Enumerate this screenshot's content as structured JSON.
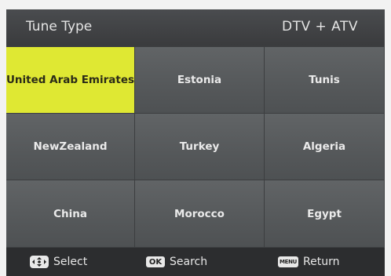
{
  "header": {
    "title": "Tune Type",
    "mode": "DTV + ATV"
  },
  "countries": [
    {
      "label": "United Arab Emirates",
      "selected": true
    },
    {
      "label": "Estonia",
      "selected": false
    },
    {
      "label": "Tunis",
      "selected": false
    },
    {
      "label": "NewZealand",
      "selected": false
    },
    {
      "label": "Turkey",
      "selected": false
    },
    {
      "label": "Algeria",
      "selected": false
    },
    {
      "label": "China",
      "selected": false
    },
    {
      "label": "Morocco",
      "selected": false
    },
    {
      "label": "Egypt",
      "selected": false
    }
  ],
  "footer": {
    "select_label": "Select",
    "search_key": "OK",
    "search_label": "Search",
    "return_key": "MENU",
    "return_label": "Return"
  },
  "colors": {
    "selected_background": "#dfe833",
    "cell_background": "#5b5e60",
    "footer_background": "#2c2d2f"
  },
  "icons": {
    "select": "navigation-dpad-icon",
    "search": "ok-key-icon",
    "return": "menu-key-icon"
  }
}
